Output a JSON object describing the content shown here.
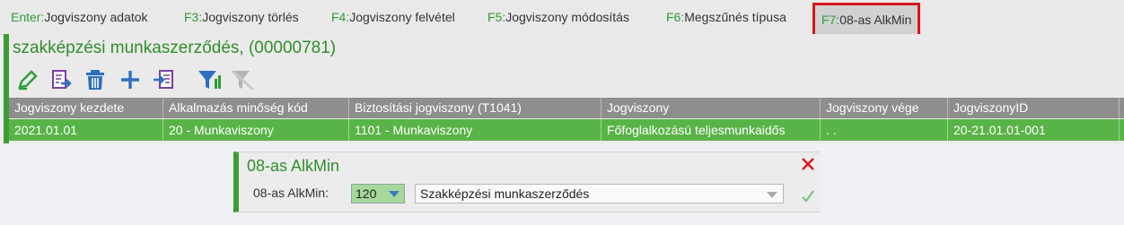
{
  "fkeys": [
    {
      "key": "Enter:",
      "label": "Jogviszony adatok"
    },
    {
      "key": "F3:",
      "label": "Jogviszony törlés"
    },
    {
      "key": "F4:",
      "label": "Jogviszony felvétel"
    },
    {
      "key": "F5:",
      "label": "Jogviszony módosítás"
    },
    {
      "key": "F6:",
      "label": "Megszűnés típusa"
    },
    {
      "key": "F7:",
      "label": "08-as AlkMin"
    }
  ],
  "panel": {
    "title": "szakképzési munkaszerződés, (00000781)",
    "toolbar": [
      {
        "icon": "edit-pencil-icon"
      },
      {
        "icon": "export-document-icon"
      },
      {
        "icon": "trash-icon"
      },
      {
        "icon": "add-plus-icon"
      },
      {
        "icon": "import-document-icon"
      },
      {
        "icon": "filter-icon"
      },
      {
        "icon": "clear-filter-icon"
      }
    ]
  },
  "grid": {
    "columns": [
      "Jogviszony kezdete",
      "Alkalmazás minőség kód",
      "Biztosítási jogviszony (T1041)",
      "Jogviszony",
      "Jogviszony vége",
      "JogviszonyID"
    ],
    "row": [
      "2021.01.01",
      "20 - Munkaviszony",
      "1101 - Munkaviszony",
      "Főfoglalkozású teljesmunkaidős",
      ". .",
      "20-21.01.01-001"
    ]
  },
  "dialog": {
    "title": "08-as AlkMin",
    "label": "08-as AlkMin:",
    "code_value": "120",
    "select_value": "Szakképzési munkaszerződés"
  },
  "colors": {
    "accent_green": "#3f9c35",
    "row_green": "#59b447",
    "header_gray": "#8e8e8e",
    "highlight_red": "#d8151d"
  }
}
